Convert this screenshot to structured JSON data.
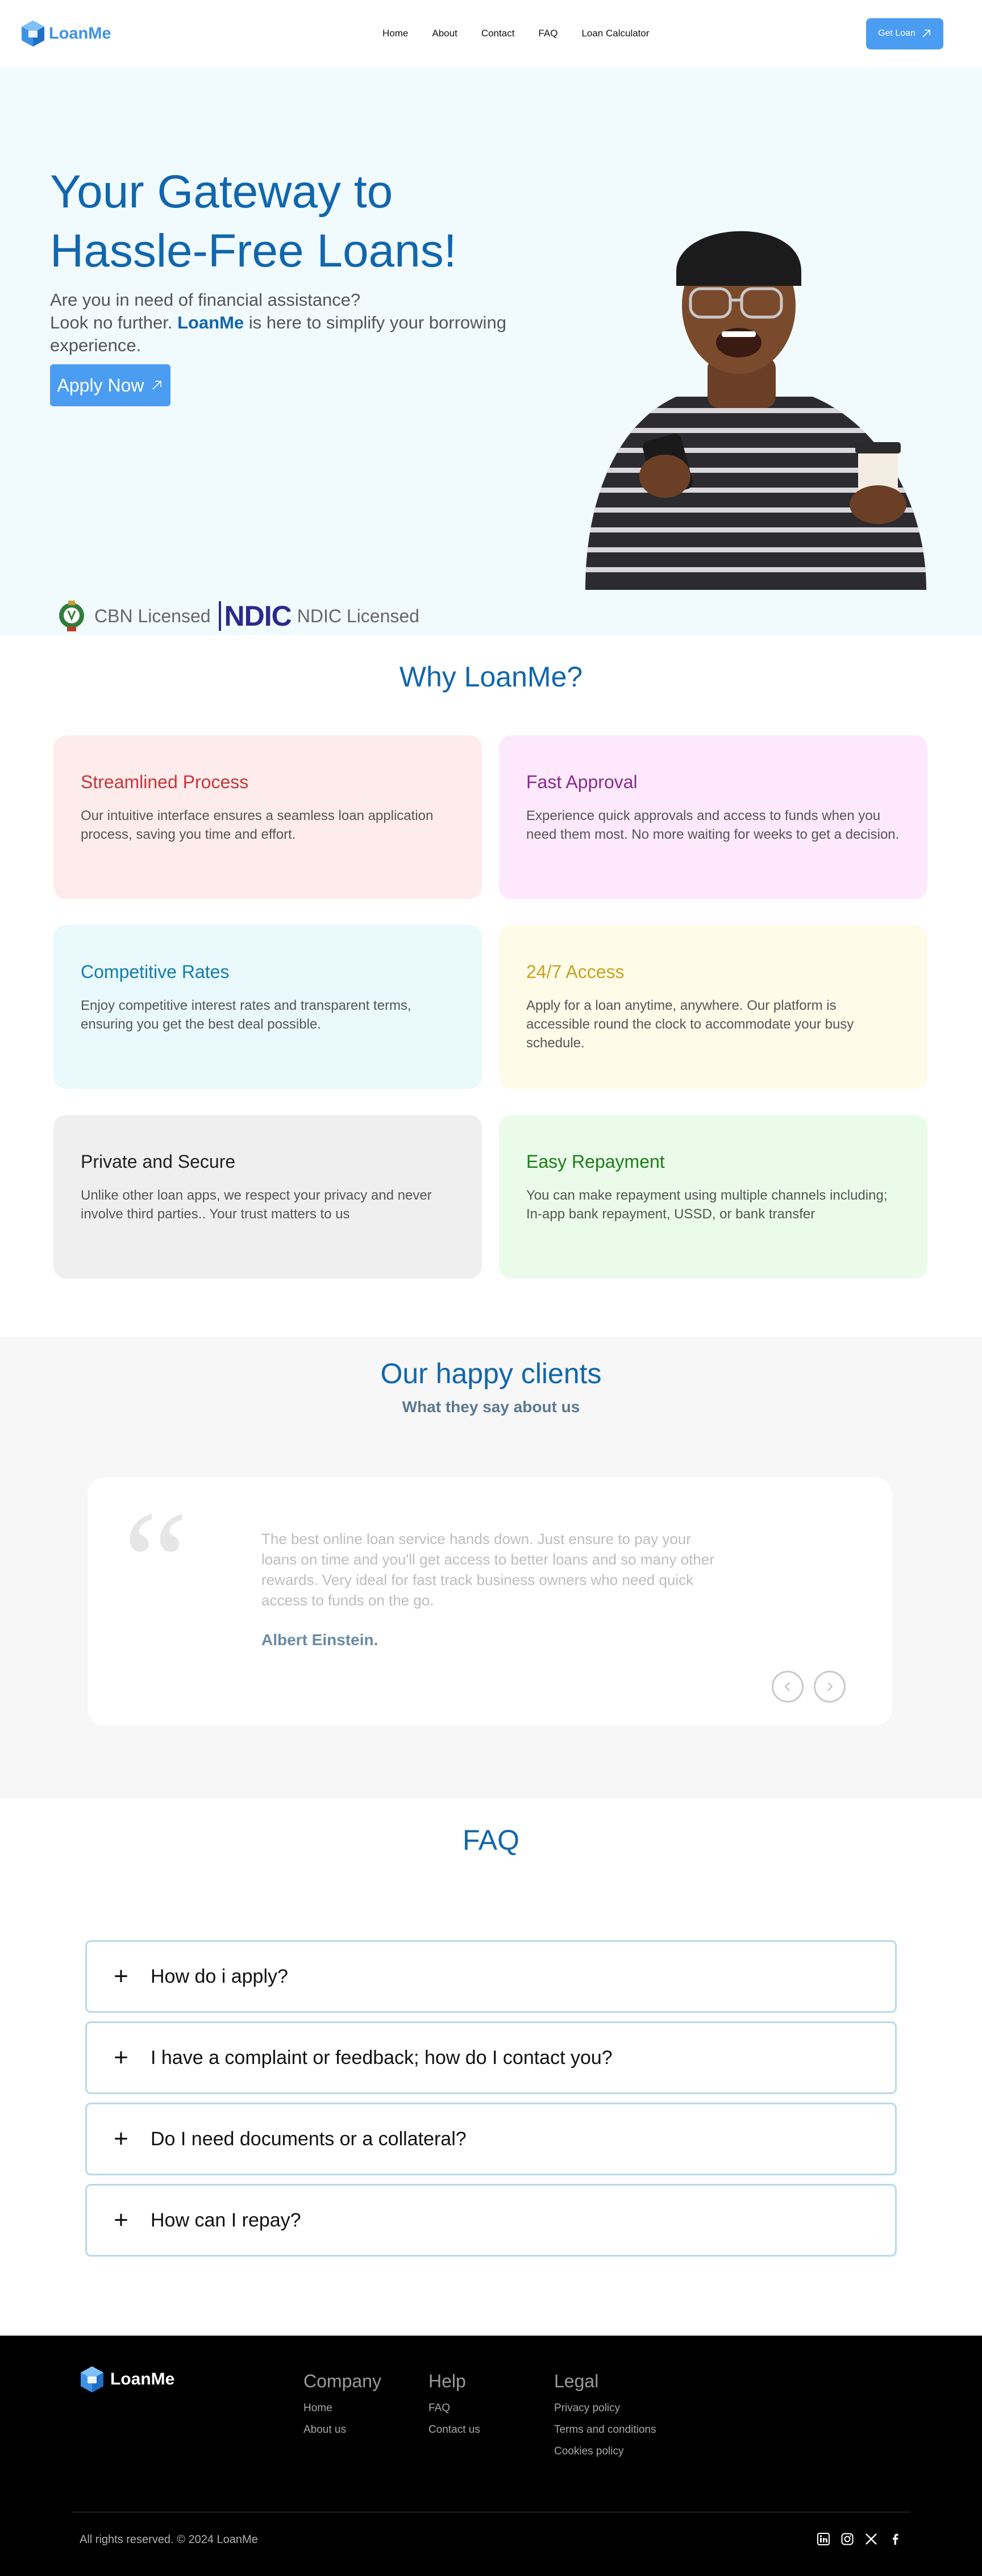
{
  "brand": {
    "name": "LoanMe",
    "accent": "#4b9df2",
    "title_color": "#1166ad"
  },
  "nav": {
    "links": [
      "Home",
      "About",
      "Contact",
      "FAQ",
      "Loan Calculator"
    ],
    "cta_label": "Get Loan"
  },
  "hero": {
    "title": "Your Gateway to Hassle-Free Loans!",
    "sub_line1": "Are you in need of financial assistance?",
    "sub_line2_pre": "Look no further.",
    "sub_brand": "LoanMe",
    "sub_line2_post": "is here to simplify your borrowing experience.",
    "apply_label": "Apply Now",
    "cbn_label": "CBN Licensed",
    "ndic_logo": "NDIC",
    "ndic_label": "NDIC Licensed"
  },
  "why": {
    "title": "Why LoanMe?",
    "cards": [
      {
        "title": "Streamlined Process",
        "text": "Our intuitive interface ensures a seamless loan application process, saving you time and effort.",
        "bg": "#fdeceb",
        "color": "#c9363b"
      },
      {
        "title": "Fast Approval",
        "text": "Experience quick approvals and access to funds when you need them most. No more waiting for weeks to get a decision.",
        "bg": "#fde9fb",
        "color": "#8a2a92"
      },
      {
        "title": "Competitive Rates",
        "text": "Enjoy competitive interest rates and transparent terms, ensuring you get the best deal possible.",
        "bg": "#e9f9fc",
        "color": "#137dab"
      },
      {
        "title": "24/7 Access",
        "text": "Apply for a loan anytime, anywhere. Our platform is accessible round the clock to accommodate your busy schedule.",
        "bg": "#fefbe9",
        "color": "#c9a222"
      },
      {
        "title": "Private and Secure",
        "text": "Unlike other loan apps, we respect your privacy and never involve third parties.. Your trust matters to us",
        "bg": "#efefef",
        "color": "#222222"
      },
      {
        "title": "Easy Repayment",
        "text": "You can make repayment using multiple channels including; In-app bank repayment, USSD, or bank transfer",
        "bg": "#eafce9",
        "color": "#1e7d1a"
      }
    ]
  },
  "testimonials": {
    "title": "Our happy clients",
    "subtitle": "What they say about us",
    "quote": "The best online loan service hands down. Just ensure to pay your loans on time and you'll get access to better loans and so many other rewards. Very ideal for fast track business owners who need quick access to funds on the go.",
    "author": "Albert Einstein."
  },
  "faq": {
    "title": "FAQ",
    "items": [
      "How do i apply?",
      "I have a complaint or feedback; how do I contact you?",
      "Do I need documents or a collateral?",
      "How can I repay?"
    ]
  },
  "footer": {
    "logo": "LoanMe",
    "company": {
      "heading": "Company",
      "links": [
        "Home",
        "About us"
      ]
    },
    "help": {
      "heading": "Help",
      "links": [
        "FAQ",
        "Contact us"
      ]
    },
    "legal": {
      "heading": "Legal",
      "links": [
        "Privacy policy",
        "Terms and conditions",
        "Cookies policy"
      ]
    },
    "copyright": "All rights reserved. © 2024 LoanMe",
    "socials": [
      "linkedin-icon",
      "instagram-icon",
      "x-icon",
      "facebook-icon"
    ]
  }
}
